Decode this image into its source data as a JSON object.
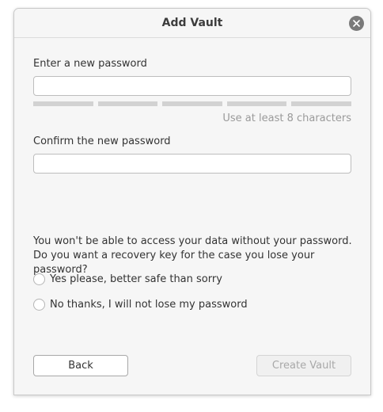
{
  "window": {
    "title": "Add Vault",
    "close_icon": "close-icon"
  },
  "password": {
    "label": "Enter a new password",
    "value": "",
    "strength_segments": 5,
    "strength_filled": 0,
    "hint": "Use at least 8 characters"
  },
  "confirm": {
    "label": "Confirm the new password",
    "value": ""
  },
  "recovery": {
    "question": "You won't be able to access your data without your password. Do you want a recovery key for the case you lose your password?",
    "options": [
      {
        "label": "Yes please, better safe than sorry",
        "selected": false
      },
      {
        "label": "No thanks, I will not lose my password",
        "selected": false
      }
    ]
  },
  "buttons": {
    "back_label": "Back",
    "create_label": "Create Vault",
    "create_enabled": false
  },
  "colors": {
    "window_bg": "#f6f6f6",
    "strength_empty": "#d2d2d2",
    "hint_text": "#9a9a9a",
    "disabled_text": "#a8a8a8"
  }
}
